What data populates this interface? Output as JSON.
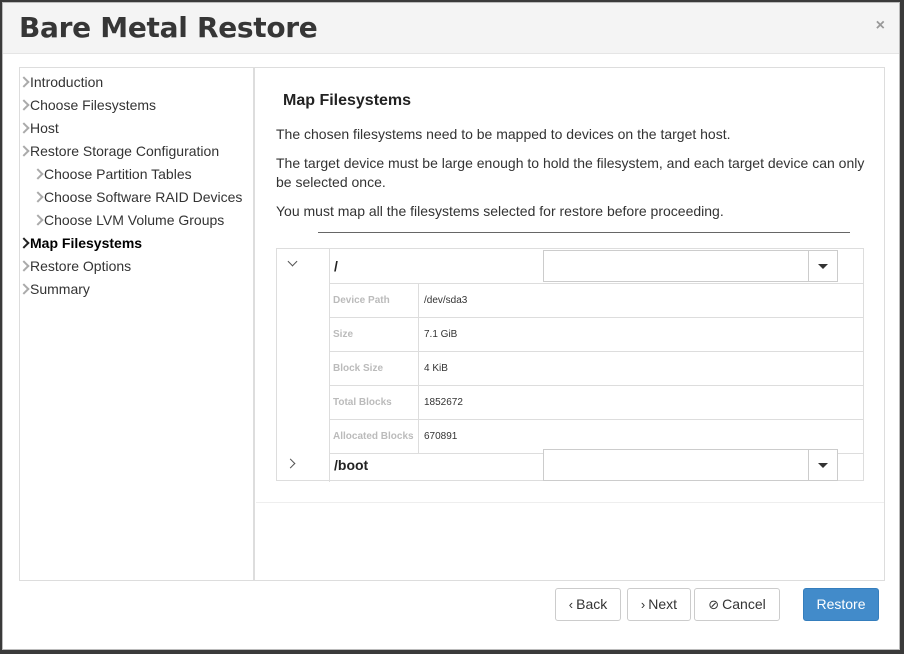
{
  "dialog": {
    "title": "Bare Metal Restore",
    "close_symbol": "×"
  },
  "steps": [
    {
      "label": "Introduction",
      "sub": false,
      "active": false
    },
    {
      "label": "Choose Filesystems",
      "sub": false,
      "active": false
    },
    {
      "label": "Host",
      "sub": false,
      "active": false
    },
    {
      "label": "Restore Storage Configuration",
      "sub": false,
      "active": false
    },
    {
      "label": "Choose Partition Tables",
      "sub": true,
      "active": false
    },
    {
      "label": "Choose Software RAID Devices",
      "sub": true,
      "active": false
    },
    {
      "label": "Choose LVM Volume Groups",
      "sub": true,
      "active": false
    },
    {
      "label": "Map Filesystems",
      "sub": false,
      "active": true
    },
    {
      "label": "Restore Options",
      "sub": false,
      "active": false
    },
    {
      "label": "Summary",
      "sub": false,
      "active": false
    }
  ],
  "content": {
    "heading": "Map Filesystems",
    "paragraphs": [
      "The chosen filesystems need to be mapped to devices on the target host.",
      "The target device must be large enough to hold the filesystem, and each target device can only be selected once.",
      "You must map all the filesystems selected for restore before proceeding."
    ]
  },
  "filesystems": [
    {
      "name": "/",
      "expanded": true,
      "target_value": "",
      "details": [
        {
          "key": "Device Path",
          "value": "/dev/sda3"
        },
        {
          "key": "Size",
          "value": "7.1 GiB"
        },
        {
          "key": "Block Size",
          "value": "4 KiB"
        },
        {
          "key": "Total Blocks",
          "value": "1852672"
        },
        {
          "key": "Allocated Blocks",
          "value": "670891"
        }
      ]
    },
    {
      "name": "/boot",
      "expanded": false,
      "target_value": "",
      "details": []
    }
  ],
  "buttons": {
    "back": {
      "symbol": "‹",
      "label": "Back"
    },
    "next": {
      "symbol": "›",
      "label": "Next"
    },
    "cancel": {
      "symbol": "⊘",
      "label": "Cancel"
    },
    "restore": {
      "label": "Restore"
    }
  },
  "colors": {
    "primary": "#428bca",
    "header_bg": "#f4f4f4"
  }
}
